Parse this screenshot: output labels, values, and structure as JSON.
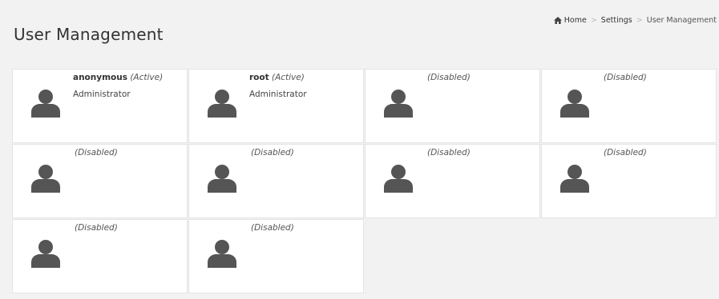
{
  "header": {
    "title": "User Management"
  },
  "breadcrumb": {
    "home": "Home",
    "settings": "Settings",
    "current": "User Management",
    "separator": ">"
  },
  "users": [
    {
      "name": "anonymous",
      "status": "(Active)",
      "role": "Administrator"
    },
    {
      "name": "root",
      "status": "(Active)",
      "role": "Administrator"
    },
    {
      "name": "",
      "status": "(Disabled)",
      "role": ""
    },
    {
      "name": "",
      "status": "(Disabled)",
      "role": ""
    },
    {
      "name": "",
      "status": "(Disabled)",
      "role": ""
    },
    {
      "name": "",
      "status": "(Disabled)",
      "role": ""
    },
    {
      "name": "",
      "status": "(Disabled)",
      "role": ""
    },
    {
      "name": "",
      "status": "(Disabled)",
      "role": ""
    },
    {
      "name": "",
      "status": "(Disabled)",
      "role": ""
    },
    {
      "name": "",
      "status": "(Disabled)",
      "role": ""
    }
  ],
  "colors": {
    "background": "#f2f2f2",
    "card": "#ffffff",
    "avatar": "#555555"
  },
  "icons": {
    "home": "home-icon",
    "avatar": "user-avatar-icon"
  }
}
